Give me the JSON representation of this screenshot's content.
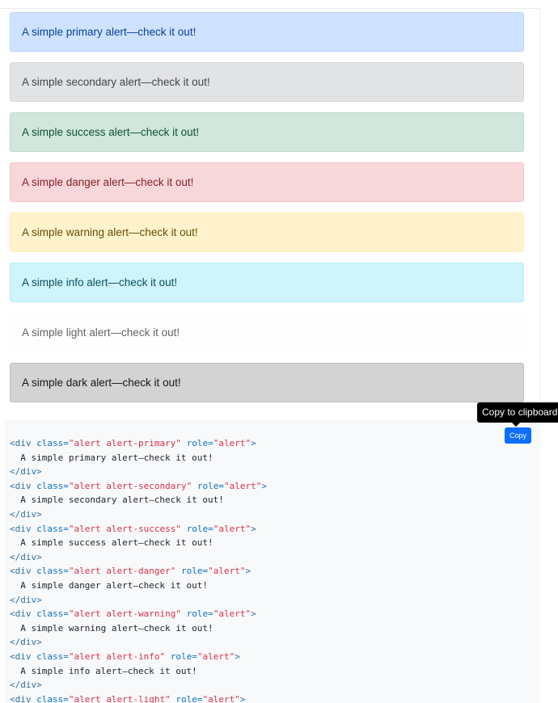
{
  "alerts": [
    {
      "variant": "primary",
      "text": "A simple primary alert—check it out!",
      "bg": "#cfe2ff",
      "border": "#b6d4fe",
      "color": "#084298"
    },
    {
      "variant": "secondary",
      "text": "A simple secondary alert—check it out!",
      "bg": "#e2e3e5",
      "border": "#d3d6d8",
      "color": "#41464b"
    },
    {
      "variant": "success",
      "text": "A simple success alert—check it out!",
      "bg": "#d1e7dd",
      "border": "#badbcc",
      "color": "#0f5132"
    },
    {
      "variant": "danger",
      "text": "A simple danger alert—check it out!",
      "bg": "#f8d7da",
      "border": "#f5c2c7",
      "color": "#842029"
    },
    {
      "variant": "warning",
      "text": "A simple warning alert—check it out!",
      "bg": "#fff3cd",
      "border": "#ffecb5",
      "color": "#664d03"
    },
    {
      "variant": "info",
      "text": "A simple info alert—check it out!",
      "bg": "#cff4fc",
      "border": "#b6effb",
      "color": "#055160"
    },
    {
      "variant": "light",
      "text": "A simple light alert—check it out!",
      "bg": "#fefefe",
      "border": "#fdfdfe",
      "color": "#636464"
    },
    {
      "variant": "dark",
      "text": "A simple dark alert—check it out!",
      "bg": "#d3d3d4",
      "border": "#bcbebf",
      "color": "#141619"
    }
  ],
  "tooltip": {
    "text": "Copy to clipboard"
  },
  "copy_button": {
    "label": "Copy"
  },
  "code": {
    "colors": {
      "tag": "#2f6f9f",
      "attr": "#0b72c4",
      "value": "#d7304a",
      "text": "#212529"
    },
    "lines": [
      [
        {
          "t": "tag",
          "v": "<div "
        },
        {
          "t": "attr",
          "v": "class="
        },
        {
          "t": "val",
          "v": "\"alert alert-primary\""
        },
        {
          "t": "text",
          "v": " "
        },
        {
          "t": "attr",
          "v": "role="
        },
        {
          "t": "val",
          "v": "\"alert\""
        },
        {
          "t": "tag",
          "v": ">"
        }
      ],
      [
        {
          "t": "text",
          "v": "  A simple primary alert—check it out!"
        }
      ],
      [
        {
          "t": "tag",
          "v": "</div>"
        }
      ],
      [
        {
          "t": "tag",
          "v": "<div "
        },
        {
          "t": "attr",
          "v": "class="
        },
        {
          "t": "val",
          "v": "\"alert alert-secondary\""
        },
        {
          "t": "text",
          "v": " "
        },
        {
          "t": "attr",
          "v": "role="
        },
        {
          "t": "val",
          "v": "\"alert\""
        },
        {
          "t": "tag",
          "v": ">"
        }
      ],
      [
        {
          "t": "text",
          "v": "  A simple secondary alert—check it out!"
        }
      ],
      [
        {
          "t": "tag",
          "v": "</div>"
        }
      ],
      [
        {
          "t": "tag",
          "v": "<div "
        },
        {
          "t": "attr",
          "v": "class="
        },
        {
          "t": "val",
          "v": "\"alert alert-success\""
        },
        {
          "t": "text",
          "v": " "
        },
        {
          "t": "attr",
          "v": "role="
        },
        {
          "t": "val",
          "v": "\"alert\""
        },
        {
          "t": "tag",
          "v": ">"
        }
      ],
      [
        {
          "t": "text",
          "v": "  A simple success alert—check it out!"
        }
      ],
      [
        {
          "t": "tag",
          "v": "</div>"
        }
      ],
      [
        {
          "t": "tag",
          "v": "<div "
        },
        {
          "t": "attr",
          "v": "class="
        },
        {
          "t": "val",
          "v": "\"alert alert-danger\""
        },
        {
          "t": "text",
          "v": " "
        },
        {
          "t": "attr",
          "v": "role="
        },
        {
          "t": "val",
          "v": "\"alert\""
        },
        {
          "t": "tag",
          "v": ">"
        }
      ],
      [
        {
          "t": "text",
          "v": "  A simple danger alert—check it out!"
        }
      ],
      [
        {
          "t": "tag",
          "v": "</div>"
        }
      ],
      [
        {
          "t": "tag",
          "v": "<div "
        },
        {
          "t": "attr",
          "v": "class="
        },
        {
          "t": "val",
          "v": "\"alert alert-warning\""
        },
        {
          "t": "text",
          "v": " "
        },
        {
          "t": "attr",
          "v": "role="
        },
        {
          "t": "val",
          "v": "\"alert\""
        },
        {
          "t": "tag",
          "v": ">"
        }
      ],
      [
        {
          "t": "text",
          "v": "  A simple warning alert—check it out!"
        }
      ],
      [
        {
          "t": "tag",
          "v": "</div>"
        }
      ],
      [
        {
          "t": "tag",
          "v": "<div "
        },
        {
          "t": "attr",
          "v": "class="
        },
        {
          "t": "val",
          "v": "\"alert alert-info\""
        },
        {
          "t": "text",
          "v": " "
        },
        {
          "t": "attr",
          "v": "role="
        },
        {
          "t": "val",
          "v": "\"alert\""
        },
        {
          "t": "tag",
          "v": ">"
        }
      ],
      [
        {
          "t": "text",
          "v": "  A simple info alert—check it out!"
        }
      ],
      [
        {
          "t": "tag",
          "v": "</div>"
        }
      ],
      [
        {
          "t": "tag",
          "v": "<div "
        },
        {
          "t": "attr",
          "v": "class="
        },
        {
          "t": "val",
          "v": "\"alert alert-light\""
        },
        {
          "t": "text",
          "v": " "
        },
        {
          "t": "attr",
          "v": "role="
        },
        {
          "t": "val",
          "v": "\"alert\""
        },
        {
          "t": "tag",
          "v": ">"
        }
      ]
    ]
  }
}
